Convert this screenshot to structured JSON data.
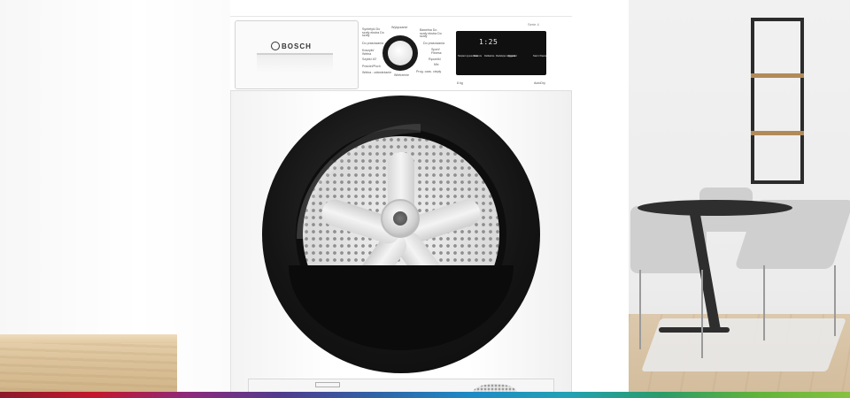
{
  "product": {
    "brand": "BOSCH",
    "series": "Serie 4",
    "capacity": "8 kg",
    "feature": "AutoDry"
  },
  "program_labels_left": [
    "Syntetyki Do szafy ekstra Do szafy",
    "Do prasowania",
    "Koszyki/ Wełna",
    "Szybki 40'",
    "Pościel/Puch",
    "Wełna - odświeżanie"
  ],
  "program_labels_top": "Wyłączanie",
  "program_labels_right": [
    "Bawełna Do szafy ekstra Do szafy",
    "Do prasowania",
    "Sport/ Fitness",
    "Mix",
    "Ręczniki",
    "Prog. czas. ciepły"
  ],
  "program_labels_bottom": "Wietrzenie",
  "display": {
    "time": "1:25",
    "buttons": [
      "Stopień wysuszenia",
      "Start za",
      "Delikatnie",
      "Redukcja zagniecień",
      "Sygnał",
      "Start / Pauza"
    ]
  },
  "colors": {
    "brand_bar": [
      "#8b1a2b",
      "#c4172c",
      "#8d2a7b",
      "#4f3b8f",
      "#2f64a8",
      "#1d8bc5",
      "#21a1b5",
      "#2a9c6a",
      "#60b33a",
      "#87c140"
    ]
  }
}
